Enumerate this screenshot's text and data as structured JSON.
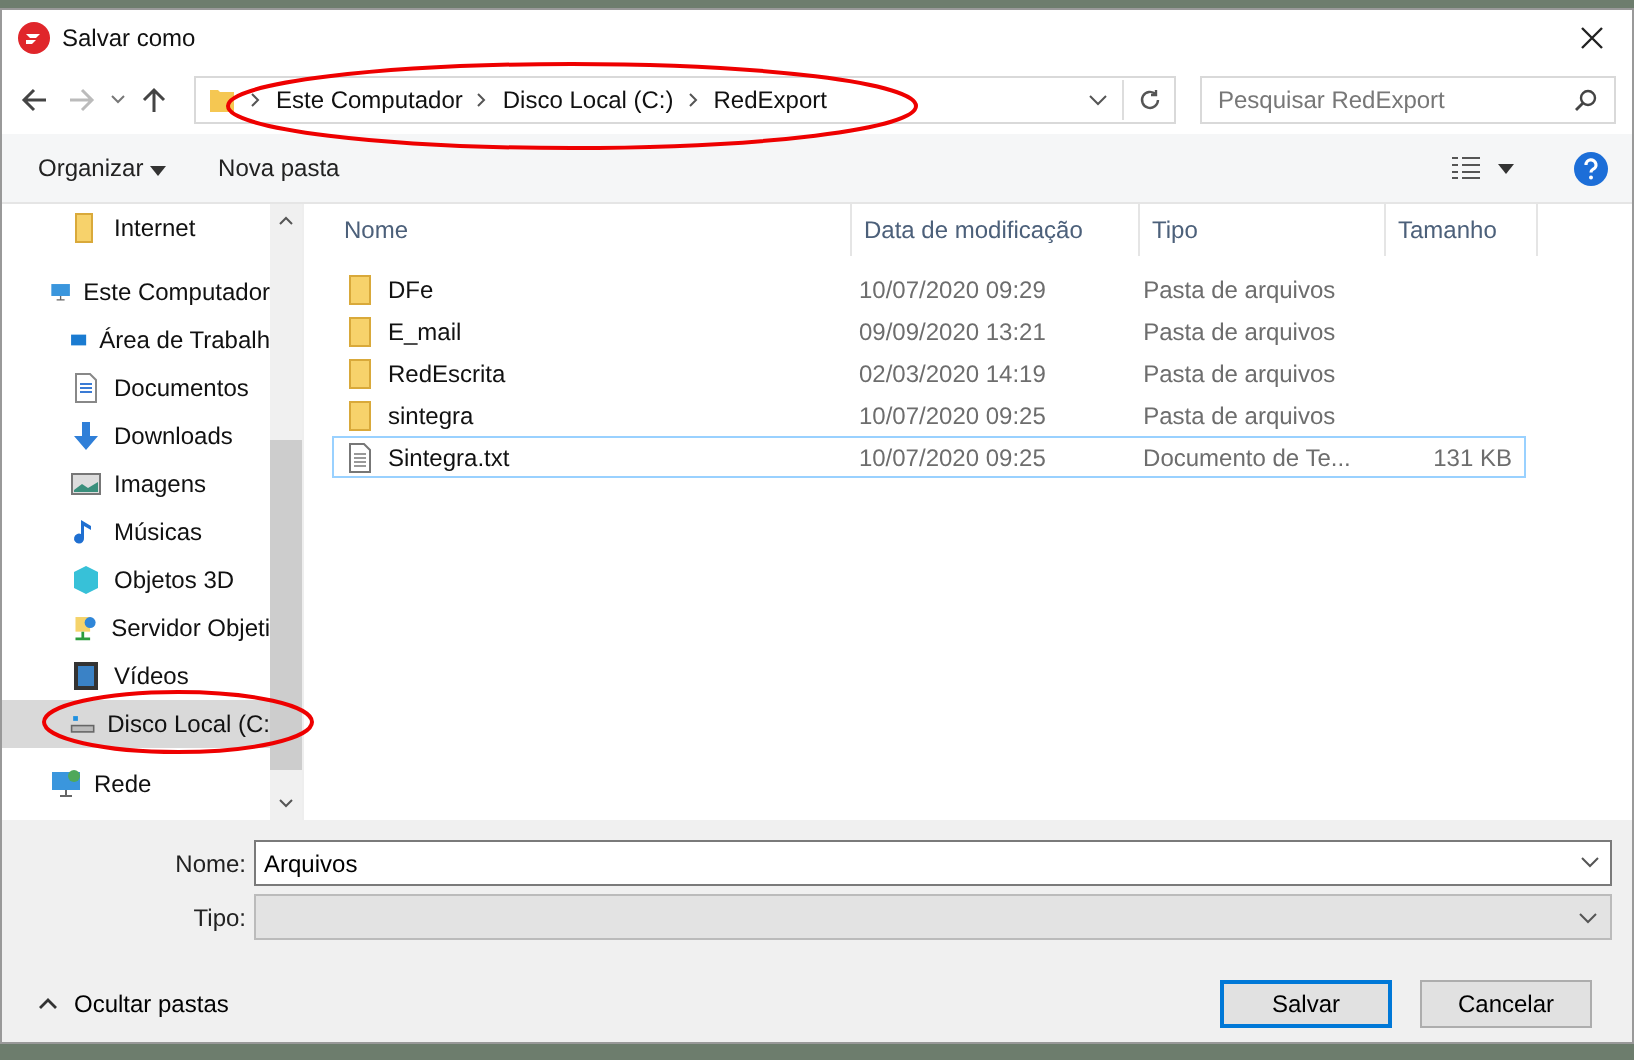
{
  "window": {
    "title": "Salvar como"
  },
  "address": {
    "crumbs": [
      "Este Computador",
      "Disco Local (C:)",
      "RedExport"
    ],
    "search_placeholder": "Pesquisar RedExport"
  },
  "toolbar": {
    "organize": "Organizar",
    "new_folder": "Nova pasta"
  },
  "sidebar": {
    "items": [
      {
        "label": "Internet",
        "kind": "folder",
        "selected": false
      },
      {
        "label": "Este Computador",
        "kind": "computer",
        "selected": false,
        "children": [
          {
            "label": "Área de Trabalh",
            "kind": "desktop",
            "selected": false
          },
          {
            "label": "Documentos",
            "kind": "document",
            "selected": false
          },
          {
            "label": "Downloads",
            "kind": "download",
            "selected": false
          },
          {
            "label": "Imagens",
            "kind": "image",
            "selected": false
          },
          {
            "label": "Músicas",
            "kind": "music",
            "selected": false
          },
          {
            "label": "Objetos 3D",
            "kind": "cube",
            "selected": false
          },
          {
            "label": "Servidor Objeti",
            "kind": "server",
            "selected": false
          },
          {
            "label": "Vídeos",
            "kind": "video",
            "selected": false
          },
          {
            "label": "Disco Local (C:",
            "kind": "drive",
            "selected": true
          }
        ]
      },
      {
        "label": "Rede",
        "kind": "network",
        "selected": false
      }
    ]
  },
  "table": {
    "columns": [
      "Nome",
      "Data de modificação",
      "Tipo",
      "Tamanho"
    ],
    "rows": [
      {
        "kind": "folder",
        "name": "DFe",
        "date": "10/07/2020 09:29",
        "type": "Pasta de arquivos",
        "selected": false
      },
      {
        "kind": "folder",
        "name": "E_mail",
        "date": "09/09/2020 13:21",
        "type": "Pasta de arquivos",
        "selected": false
      },
      {
        "kind": "folder",
        "name": "RedEscrita",
        "date": "02/03/2020 14:19",
        "type": "Pasta de arquivos",
        "selected": false
      },
      {
        "kind": "folder",
        "name": "sintegra",
        "date": "10/07/2020 09:25",
        "type": "Pasta de arquivos",
        "selected": false
      },
      {
        "kind": "file",
        "name": "Sintegra.txt",
        "date": "10/07/2020 09:25",
        "type": "Documento de Te...",
        "size": "131 KB",
        "selected": true
      }
    ]
  },
  "form": {
    "name_label": "Nome:",
    "name_value": "Arquivos",
    "type_label": "Tipo:"
  },
  "footer": {
    "hide_folders": "Ocultar pastas",
    "save": "Salvar",
    "cancel": "Cancelar"
  }
}
